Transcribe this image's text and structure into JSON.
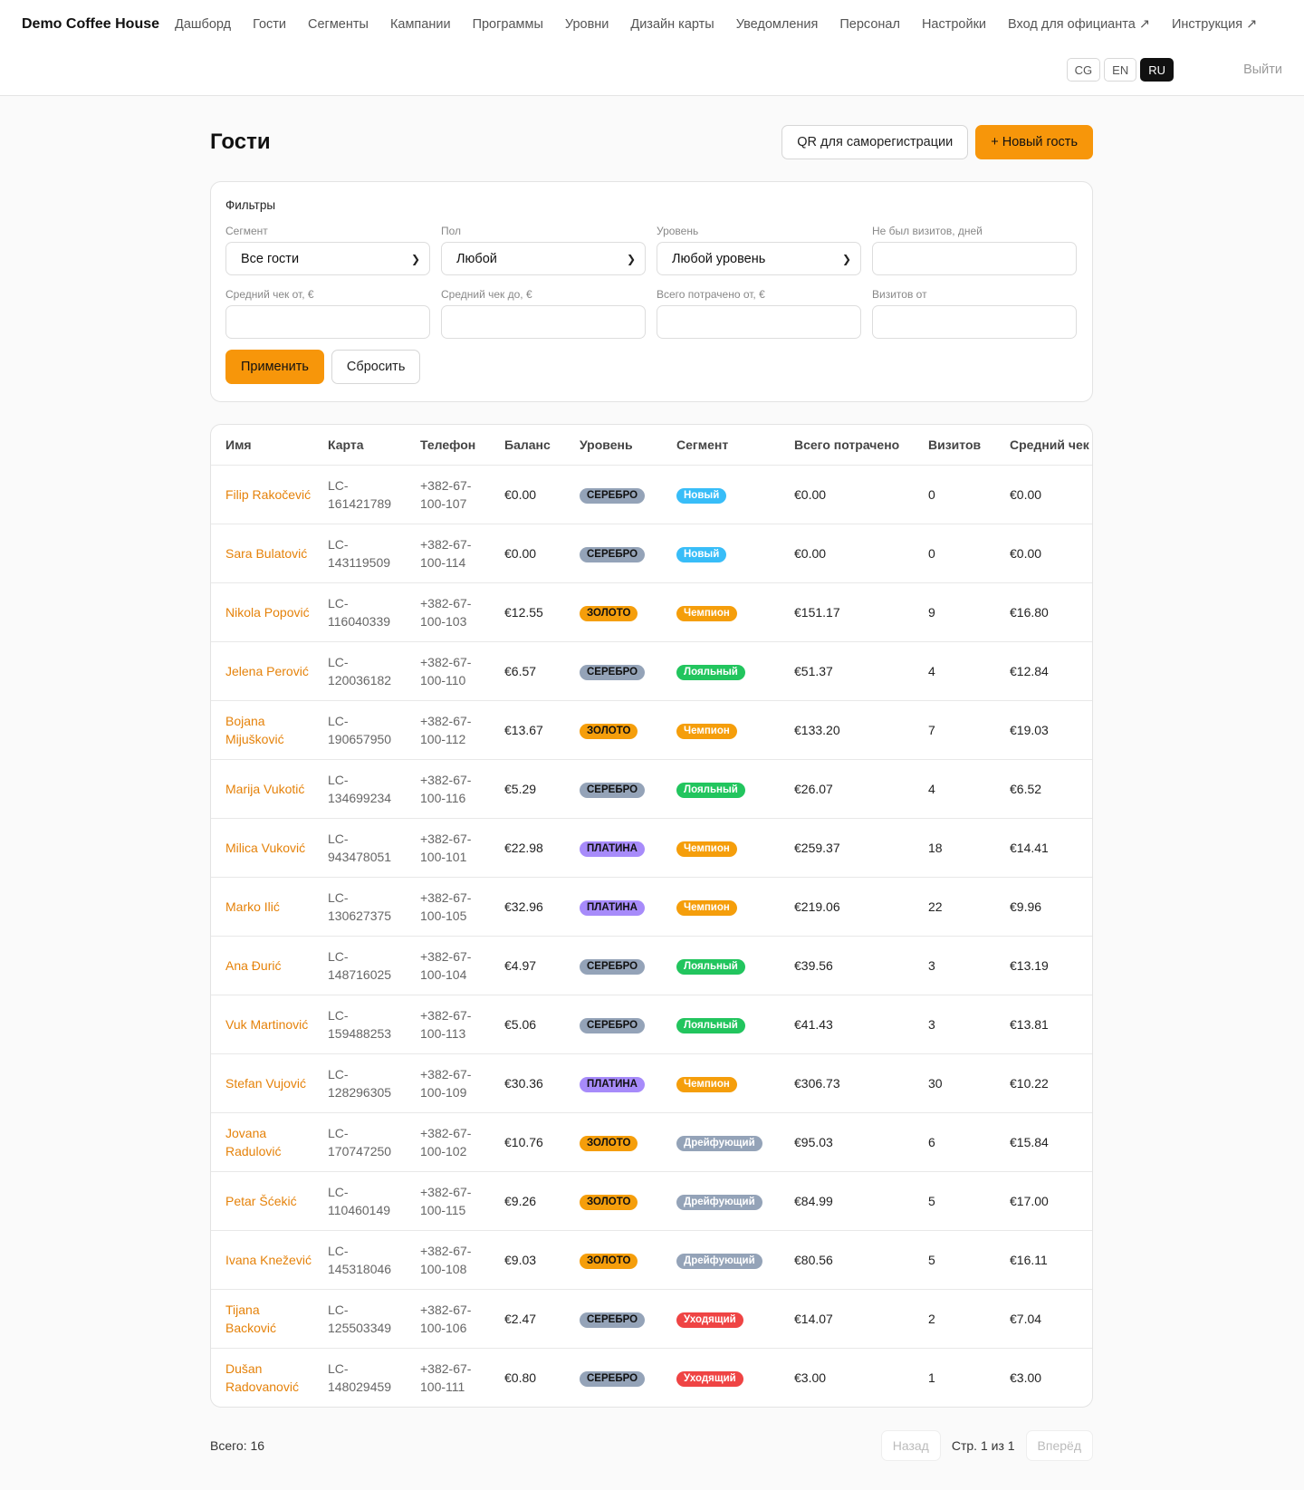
{
  "header": {
    "brand": "Demo Coffee House",
    "nav": [
      "Дашборд",
      "Гости",
      "Сегменты",
      "Кампании",
      "Программы",
      "Уровни",
      "Дизайн карты",
      "Уведомления",
      "Персонал",
      "Настройки",
      "Вход для официанта ↗",
      "Инструкция ↗"
    ],
    "languages": [
      "CG",
      "EN",
      "RU"
    ],
    "active_language": "RU",
    "logout": "Выйти"
  },
  "page": {
    "title": "Гости",
    "qr_button": "QR для саморегистрации",
    "new_guest_button": "+ Новый гость"
  },
  "filters": {
    "title": "Фильтры",
    "fields": [
      {
        "label": "Сегмент",
        "value": "Все гости",
        "type": "select"
      },
      {
        "label": "Пол",
        "value": "Любой",
        "type": "select"
      },
      {
        "label": "Уровень",
        "value": "Любой уровень",
        "type": "select"
      },
      {
        "label": "Не был визитов, дней",
        "value": "",
        "type": "input"
      },
      {
        "label": "Средний чек от, €",
        "value": "",
        "type": "input"
      },
      {
        "label": "Средний чек до, €",
        "value": "",
        "type": "input"
      },
      {
        "label": "Всего потрачено от, €",
        "value": "",
        "type": "input"
      },
      {
        "label": "Визитов от",
        "value": "",
        "type": "input"
      }
    ],
    "apply": "Применить",
    "reset": "Сбросить"
  },
  "table": {
    "columns": [
      "Имя",
      "Карта",
      "Телефон",
      "Баланс",
      "Уровень",
      "Сегмент",
      "Всего потрачено",
      "Визитов",
      "Средний чек"
    ],
    "rows": [
      {
        "name": "Filip Rakočević",
        "card": "LC-161421789",
        "phone": "+382-67-100-107",
        "balance": "€0.00",
        "tier": "СЕРЕБРО",
        "segment": "Новый",
        "spent": "€0.00",
        "visits": "0",
        "avg": "€0.00"
      },
      {
        "name": "Sara Bulatović",
        "card": "LC-143119509",
        "phone": "+382-67-100-114",
        "balance": "€0.00",
        "tier": "СЕРЕБРО",
        "segment": "Новый",
        "spent": "€0.00",
        "visits": "0",
        "avg": "€0.00"
      },
      {
        "name": "Nikola Popović",
        "card": "LC-116040339",
        "phone": "+382-67-100-103",
        "balance": "€12.55",
        "tier": "ЗОЛОТО",
        "segment": "Чемпион",
        "spent": "€151.17",
        "visits": "9",
        "avg": "€16.80"
      },
      {
        "name": "Jelena Perović",
        "card": "LC-120036182",
        "phone": "+382-67-100-110",
        "balance": "€6.57",
        "tier": "СЕРЕБРО",
        "segment": "Лояльный",
        "spent": "€51.37",
        "visits": "4",
        "avg": "€12.84"
      },
      {
        "name": "Bojana Mijušković",
        "card": "LC-190657950",
        "phone": "+382-67-100-112",
        "balance": "€13.67",
        "tier": "ЗОЛОТО",
        "segment": "Чемпион",
        "spent": "€133.20",
        "visits": "7",
        "avg": "€19.03"
      },
      {
        "name": "Marija Vukotić",
        "card": "LC-134699234",
        "phone": "+382-67-100-116",
        "balance": "€5.29",
        "tier": "СЕРЕБРО",
        "segment": "Лояльный",
        "spent": "€26.07",
        "visits": "4",
        "avg": "€6.52"
      },
      {
        "name": "Milica Vuković",
        "card": "LC-943478051",
        "phone": "+382-67-100-101",
        "balance": "€22.98",
        "tier": "ПЛАТИНА",
        "segment": "Чемпион",
        "spent": "€259.37",
        "visits": "18",
        "avg": "€14.41"
      },
      {
        "name": "Marko Ilić",
        "card": "LC-130627375",
        "phone": "+382-67-100-105",
        "balance": "€32.96",
        "tier": "ПЛАТИНА",
        "segment": "Чемпион",
        "spent": "€219.06",
        "visits": "22",
        "avg": "€9.96"
      },
      {
        "name": "Ana Đurić",
        "card": "LC-148716025",
        "phone": "+382-67-100-104",
        "balance": "€4.97",
        "tier": "СЕРЕБРО",
        "segment": "Лояльный",
        "spent": "€39.56",
        "visits": "3",
        "avg": "€13.19"
      },
      {
        "name": "Vuk Martinović",
        "card": "LC-159488253",
        "phone": "+382-67-100-113",
        "balance": "€5.06",
        "tier": "СЕРЕБРО",
        "segment": "Лояльный",
        "spent": "€41.43",
        "visits": "3",
        "avg": "€13.81"
      },
      {
        "name": "Stefan Vujović",
        "card": "LC-128296305",
        "phone": "+382-67-100-109",
        "balance": "€30.36",
        "tier": "ПЛАТИНА",
        "segment": "Чемпион",
        "spent": "€306.73",
        "visits": "30",
        "avg": "€10.22"
      },
      {
        "name": "Jovana Radulović",
        "card": "LC-170747250",
        "phone": "+382-67-100-102",
        "balance": "€10.76",
        "tier": "ЗОЛОТО",
        "segment": "Дрейфующий",
        "spent": "€95.03",
        "visits": "6",
        "avg": "€15.84"
      },
      {
        "name": "Petar Šćekić",
        "card": "LC-110460149",
        "phone": "+382-67-100-115",
        "balance": "€9.26",
        "tier": "ЗОЛОТО",
        "segment": "Дрейфующий",
        "spent": "€84.99",
        "visits": "5",
        "avg": "€17.00"
      },
      {
        "name": "Ivana Knežević",
        "card": "LC-145318046",
        "phone": "+382-67-100-108",
        "balance": "€9.03",
        "tier": "ЗОЛОТО",
        "segment": "Дрейфующий",
        "spent": "€80.56",
        "visits": "5",
        "avg": "€16.11"
      },
      {
        "name": "Tijana Backović",
        "card": "LC-125503349",
        "phone": "+382-67-100-106",
        "balance": "€2.47",
        "tier": "СЕРЕБРО",
        "segment": "Уходящий",
        "spent": "€14.07",
        "visits": "2",
        "avg": "€7.04"
      },
      {
        "name": "Dušan Radovanović",
        "card": "LC-148029459",
        "phone": "+382-67-100-111",
        "balance": "€0.80",
        "tier": "СЕРЕБРО",
        "segment": "Уходящий",
        "spent": "€3.00",
        "visits": "1",
        "avg": "€3.00"
      }
    ]
  },
  "colors": {
    "accent": "#f7960a",
    "tier": {
      "СЕРЕБРО": "#94a3b8",
      "ЗОЛОТО": "#f59e0b",
      "ПЛАТИНА": "#a78bfa"
    },
    "segment": {
      "Новый": "#38bdf8",
      "Чемпион": "#f59e0b",
      "Лояльный": "#22c55e",
      "Дрейфующий": "#94a3b8",
      "Уходящий": "#ef4444"
    }
  },
  "footer": {
    "total": "Всего: 16",
    "prev": "Назад",
    "page_info": "Стр. 1 из 1",
    "next": "Вперёд"
  }
}
